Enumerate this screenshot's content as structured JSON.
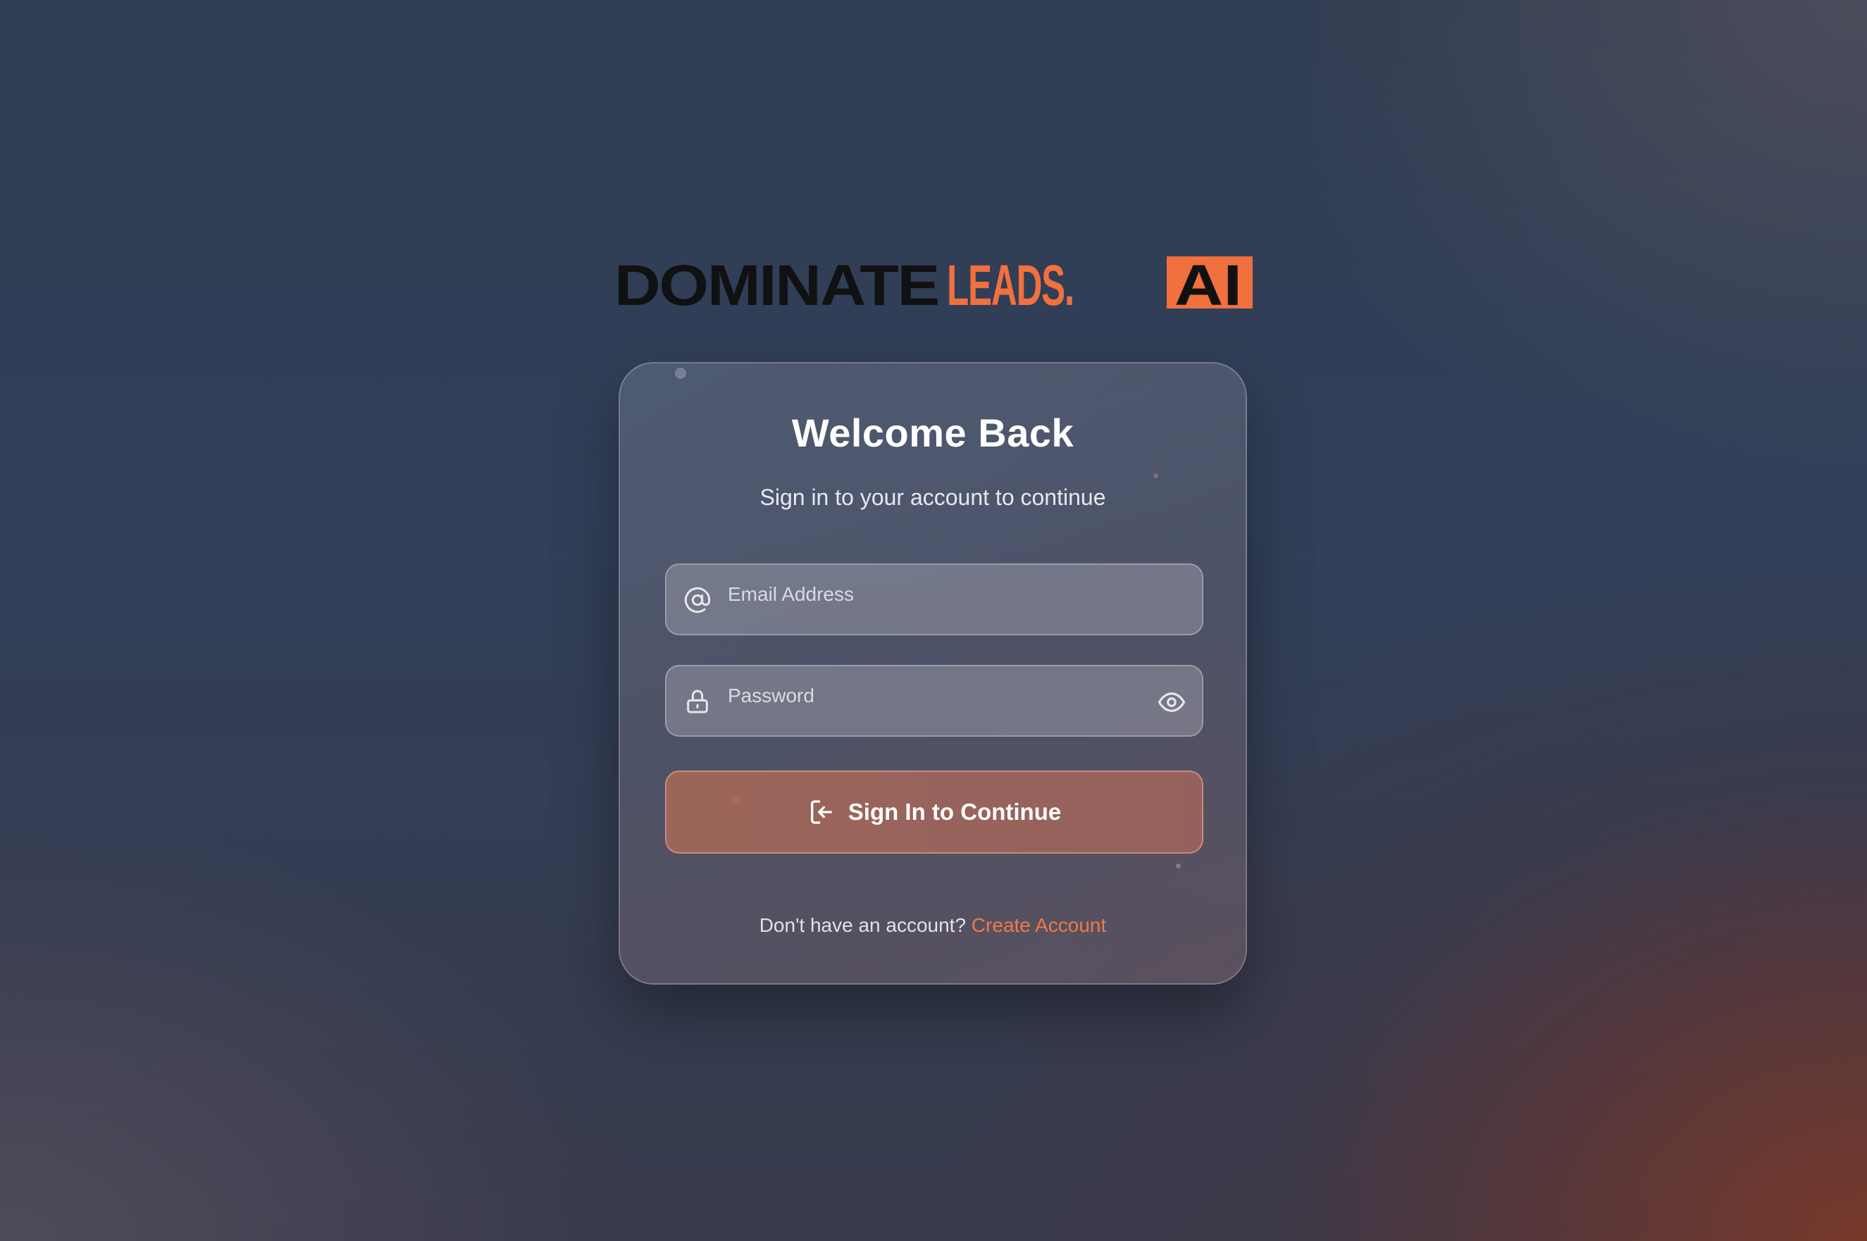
{
  "brand": {
    "logo_part1": "DOMINATE",
    "logo_part2": "LEADS.",
    "logo_part3": "AI",
    "accent_color": "#f0703e",
    "dark_color": "#111111"
  },
  "login": {
    "title": "Welcome Back",
    "subtitle": "Sign in to your account to continue",
    "email": {
      "icon": "at-sign-icon",
      "placeholder": "Email Address",
      "value": ""
    },
    "password": {
      "icon": "lock-icon",
      "placeholder": "Password",
      "value": "",
      "toggle_icon": "eye-icon"
    },
    "submit": {
      "icon": "login-icon",
      "label": "Sign In to Continue"
    },
    "footer": {
      "prompt": "Don't have an account?",
      "link": "Create Account"
    }
  }
}
